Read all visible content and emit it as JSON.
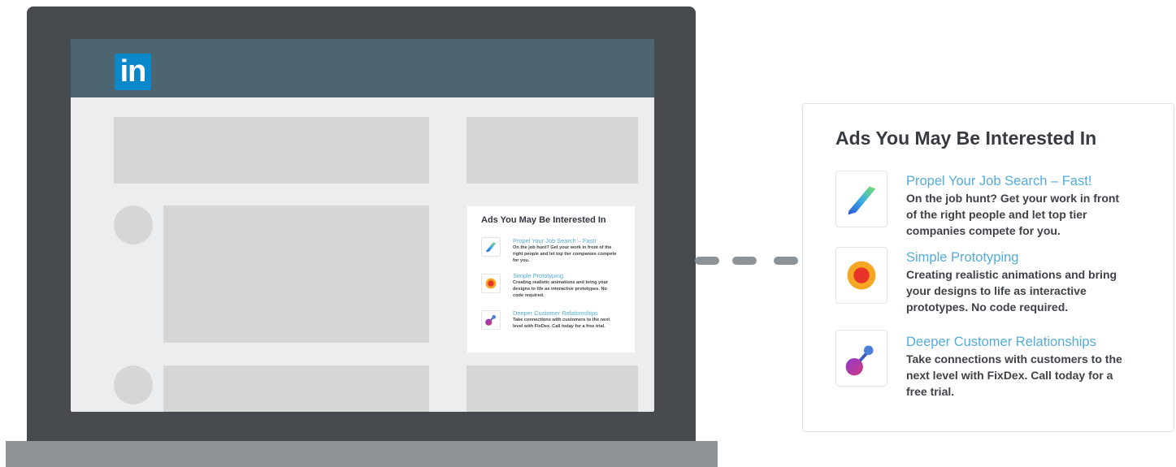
{
  "brand": {
    "logo_text": "in",
    "logo_color": "#0b88c9",
    "header_color": "#4d6471"
  },
  "ads_panel": {
    "title": "Ads You May Be Interested In",
    "accent_color": "#55acd9",
    "items": [
      {
        "icon": "gradient-arrow-icon",
        "headline": "Propel Your Job Search – Fast!",
        "body": "On the job hunt?  Get your work in front of the right people and let top tier companies compete for you."
      },
      {
        "icon": "orange-circle-icon",
        "headline": "Simple Prototyping",
        "body": "Creating realistic animations and bring your designs to life as interactive prototypes.  No code required."
      },
      {
        "icon": "connection-node-icon",
        "headline": "Deeper Customer Relationships",
        "body": "Take connections with customers to the next level with FixDex.  Call today for a free trial."
      }
    ]
  }
}
